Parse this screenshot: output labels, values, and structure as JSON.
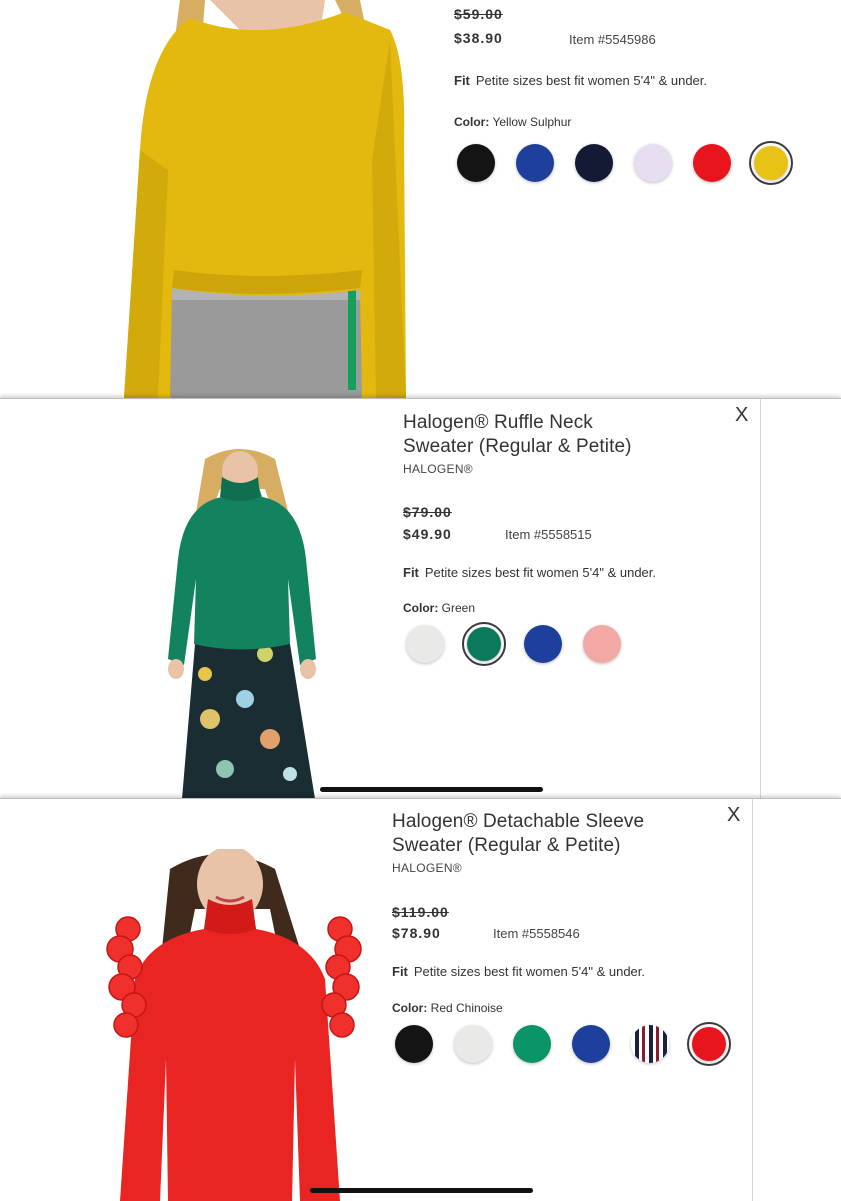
{
  "products": [
    {
      "title_line1": "",
      "title_line2": "",
      "brand": "",
      "original_price": "$59.00",
      "sale_price": "$38.90",
      "item_number": "Item #5545986",
      "fit_label": "Fit",
      "fit_text": "Petite sizes best fit women 5'4\" & under.",
      "color_label": "Color:",
      "color_value": "Yellow Sulphur",
      "swatches": [
        {
          "name": "Black",
          "hex": "#141414"
        },
        {
          "name": "Blue",
          "hex": "#1e3f9c"
        },
        {
          "name": "Navy",
          "hex": "#141a33"
        },
        {
          "name": "Lilac",
          "hex": "#e6dff0"
        },
        {
          "name": "Red",
          "hex": "#e8141e"
        },
        {
          "name": "Yellow Sulphur",
          "hex": "#e6c315",
          "selected": true
        }
      ]
    },
    {
      "title_line1": "Halogen® Ruffle Neck",
      "title_line2": "Sweater (Regular & Petite)",
      "brand": "HALOGEN®",
      "original_price": "$79.00",
      "sale_price": "$49.90",
      "item_number": "Item #5558515",
      "fit_label": "Fit",
      "fit_text": "Petite sizes best fit women 5'4\" & under.",
      "color_label": "Color:",
      "color_value": "Green",
      "close_label": "X",
      "swatches": [
        {
          "name": "Ivory",
          "hex": "#e9e9e7"
        },
        {
          "name": "Green",
          "hex": "#0b7a5c",
          "selected": true
        },
        {
          "name": "Blue",
          "hex": "#1e3f9c"
        },
        {
          "name": "Pink",
          "hex": "#f2a9a6"
        }
      ]
    },
    {
      "title_line1": "Halogen® Detachable Sleeve",
      "title_line2": "Sweater (Regular & Petite)",
      "brand": "HALOGEN®",
      "original_price": "$119.00",
      "sale_price": "$78.90",
      "item_number": "Item #5558546",
      "fit_label": "Fit",
      "fit_text": "Petite sizes best fit women 5'4\" & under.",
      "color_label": "Color:",
      "color_value": "Red Chinoise",
      "close_label": "X",
      "swatches": [
        {
          "name": "Black",
          "hex": "#141414"
        },
        {
          "name": "Ivory",
          "hex": "#e9e9e7"
        },
        {
          "name": "Green",
          "hex": "#0a9467"
        },
        {
          "name": "Blue",
          "hex": "#1e3f9c"
        },
        {
          "name": "Stripe",
          "hex": "#1c1f3e",
          "pattern": "stripe"
        },
        {
          "name": "Red Chinoise",
          "hex": "#e8141e",
          "selected": true
        }
      ]
    }
  ],
  "colors": {
    "yellow_sweater": "#e3b90f",
    "green_sweater": "#13825e",
    "red_sweater": "#e82522",
    "skin": "#e9c3a8",
    "blonde": "#d7ad63",
    "brown_hair": "#3f2a1c",
    "skirt_dark": "#1a2d33"
  }
}
